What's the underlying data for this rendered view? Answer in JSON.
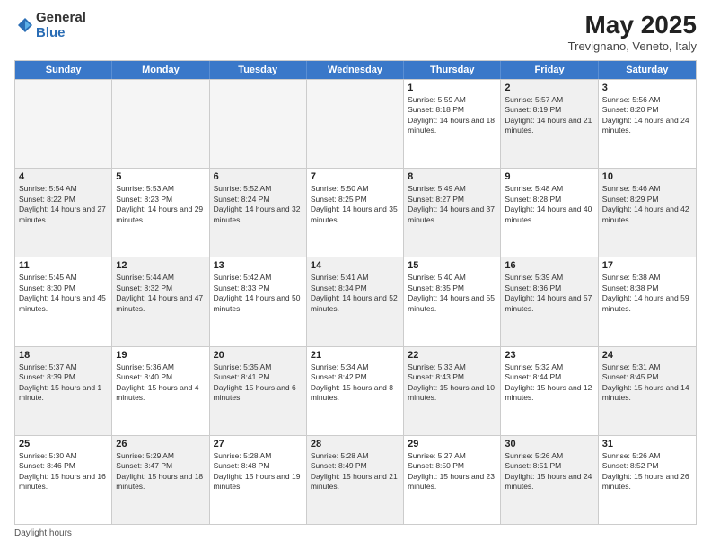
{
  "header": {
    "logo_general": "General",
    "logo_blue": "Blue",
    "month_title": "May 2025",
    "subtitle": "Trevignano, Veneto, Italy"
  },
  "days_of_week": [
    "Sunday",
    "Monday",
    "Tuesday",
    "Wednesday",
    "Thursday",
    "Friday",
    "Saturday"
  ],
  "weeks": [
    [
      {
        "day": "",
        "shaded": true,
        "empty": true
      },
      {
        "day": "",
        "shaded": true,
        "empty": true
      },
      {
        "day": "",
        "shaded": true,
        "empty": true
      },
      {
        "day": "",
        "shaded": true,
        "empty": true
      },
      {
        "day": "1",
        "sunrise": "Sunrise: 5:59 AM",
        "sunset": "Sunset: 8:18 PM",
        "daylight": "Daylight: 14 hours and 18 minutes.",
        "shaded": false
      },
      {
        "day": "2",
        "sunrise": "Sunrise: 5:57 AM",
        "sunset": "Sunset: 8:19 PM",
        "daylight": "Daylight: 14 hours and 21 minutes.",
        "shaded": true
      },
      {
        "day": "3",
        "sunrise": "Sunrise: 5:56 AM",
        "sunset": "Sunset: 8:20 PM",
        "daylight": "Daylight: 14 hours and 24 minutes.",
        "shaded": false
      }
    ],
    [
      {
        "day": "4",
        "sunrise": "Sunrise: 5:54 AM",
        "sunset": "Sunset: 8:22 PM",
        "daylight": "Daylight: 14 hours and 27 minutes.",
        "shaded": true
      },
      {
        "day": "5",
        "sunrise": "Sunrise: 5:53 AM",
        "sunset": "Sunset: 8:23 PM",
        "daylight": "Daylight: 14 hours and 29 minutes.",
        "shaded": false
      },
      {
        "day": "6",
        "sunrise": "Sunrise: 5:52 AM",
        "sunset": "Sunset: 8:24 PM",
        "daylight": "Daylight: 14 hours and 32 minutes.",
        "shaded": true
      },
      {
        "day": "7",
        "sunrise": "Sunrise: 5:50 AM",
        "sunset": "Sunset: 8:25 PM",
        "daylight": "Daylight: 14 hours and 35 minutes.",
        "shaded": false
      },
      {
        "day": "8",
        "sunrise": "Sunrise: 5:49 AM",
        "sunset": "Sunset: 8:27 PM",
        "daylight": "Daylight: 14 hours and 37 minutes.",
        "shaded": true
      },
      {
        "day": "9",
        "sunrise": "Sunrise: 5:48 AM",
        "sunset": "Sunset: 8:28 PM",
        "daylight": "Daylight: 14 hours and 40 minutes.",
        "shaded": false
      },
      {
        "day": "10",
        "sunrise": "Sunrise: 5:46 AM",
        "sunset": "Sunset: 8:29 PM",
        "daylight": "Daylight: 14 hours and 42 minutes.",
        "shaded": true
      }
    ],
    [
      {
        "day": "11",
        "sunrise": "Sunrise: 5:45 AM",
        "sunset": "Sunset: 8:30 PM",
        "daylight": "Daylight: 14 hours and 45 minutes.",
        "shaded": false
      },
      {
        "day": "12",
        "sunrise": "Sunrise: 5:44 AM",
        "sunset": "Sunset: 8:32 PM",
        "daylight": "Daylight: 14 hours and 47 minutes.",
        "shaded": true
      },
      {
        "day": "13",
        "sunrise": "Sunrise: 5:42 AM",
        "sunset": "Sunset: 8:33 PM",
        "daylight": "Daylight: 14 hours and 50 minutes.",
        "shaded": false
      },
      {
        "day": "14",
        "sunrise": "Sunrise: 5:41 AM",
        "sunset": "Sunset: 8:34 PM",
        "daylight": "Daylight: 14 hours and 52 minutes.",
        "shaded": true
      },
      {
        "day": "15",
        "sunrise": "Sunrise: 5:40 AM",
        "sunset": "Sunset: 8:35 PM",
        "daylight": "Daylight: 14 hours and 55 minutes.",
        "shaded": false
      },
      {
        "day": "16",
        "sunrise": "Sunrise: 5:39 AM",
        "sunset": "Sunset: 8:36 PM",
        "daylight": "Daylight: 14 hours and 57 minutes.",
        "shaded": true
      },
      {
        "day": "17",
        "sunrise": "Sunrise: 5:38 AM",
        "sunset": "Sunset: 8:38 PM",
        "daylight": "Daylight: 14 hours and 59 minutes.",
        "shaded": false
      }
    ],
    [
      {
        "day": "18",
        "sunrise": "Sunrise: 5:37 AM",
        "sunset": "Sunset: 8:39 PM",
        "daylight": "Daylight: 15 hours and 1 minute.",
        "shaded": true
      },
      {
        "day": "19",
        "sunrise": "Sunrise: 5:36 AM",
        "sunset": "Sunset: 8:40 PM",
        "daylight": "Daylight: 15 hours and 4 minutes.",
        "shaded": false
      },
      {
        "day": "20",
        "sunrise": "Sunrise: 5:35 AM",
        "sunset": "Sunset: 8:41 PM",
        "daylight": "Daylight: 15 hours and 6 minutes.",
        "shaded": true
      },
      {
        "day": "21",
        "sunrise": "Sunrise: 5:34 AM",
        "sunset": "Sunset: 8:42 PM",
        "daylight": "Daylight: 15 hours and 8 minutes.",
        "shaded": false
      },
      {
        "day": "22",
        "sunrise": "Sunrise: 5:33 AM",
        "sunset": "Sunset: 8:43 PM",
        "daylight": "Daylight: 15 hours and 10 minutes.",
        "shaded": true
      },
      {
        "day": "23",
        "sunrise": "Sunrise: 5:32 AM",
        "sunset": "Sunset: 8:44 PM",
        "daylight": "Daylight: 15 hours and 12 minutes.",
        "shaded": false
      },
      {
        "day": "24",
        "sunrise": "Sunrise: 5:31 AM",
        "sunset": "Sunset: 8:45 PM",
        "daylight": "Daylight: 15 hours and 14 minutes.",
        "shaded": true
      }
    ],
    [
      {
        "day": "25",
        "sunrise": "Sunrise: 5:30 AM",
        "sunset": "Sunset: 8:46 PM",
        "daylight": "Daylight: 15 hours and 16 minutes.",
        "shaded": false
      },
      {
        "day": "26",
        "sunrise": "Sunrise: 5:29 AM",
        "sunset": "Sunset: 8:47 PM",
        "daylight": "Daylight: 15 hours and 18 minutes.",
        "shaded": true
      },
      {
        "day": "27",
        "sunrise": "Sunrise: 5:28 AM",
        "sunset": "Sunset: 8:48 PM",
        "daylight": "Daylight: 15 hours and 19 minutes.",
        "shaded": false
      },
      {
        "day": "28",
        "sunrise": "Sunrise: 5:28 AM",
        "sunset": "Sunset: 8:49 PM",
        "daylight": "Daylight: 15 hours and 21 minutes.",
        "shaded": true
      },
      {
        "day": "29",
        "sunrise": "Sunrise: 5:27 AM",
        "sunset": "Sunset: 8:50 PM",
        "daylight": "Daylight: 15 hours and 23 minutes.",
        "shaded": false
      },
      {
        "day": "30",
        "sunrise": "Sunrise: 5:26 AM",
        "sunset": "Sunset: 8:51 PM",
        "daylight": "Daylight: 15 hours and 24 minutes.",
        "shaded": true
      },
      {
        "day": "31",
        "sunrise": "Sunrise: 5:26 AM",
        "sunset": "Sunset: 8:52 PM",
        "daylight": "Daylight: 15 hours and 26 minutes.",
        "shaded": false
      }
    ]
  ],
  "footer": {
    "note": "Daylight hours"
  }
}
